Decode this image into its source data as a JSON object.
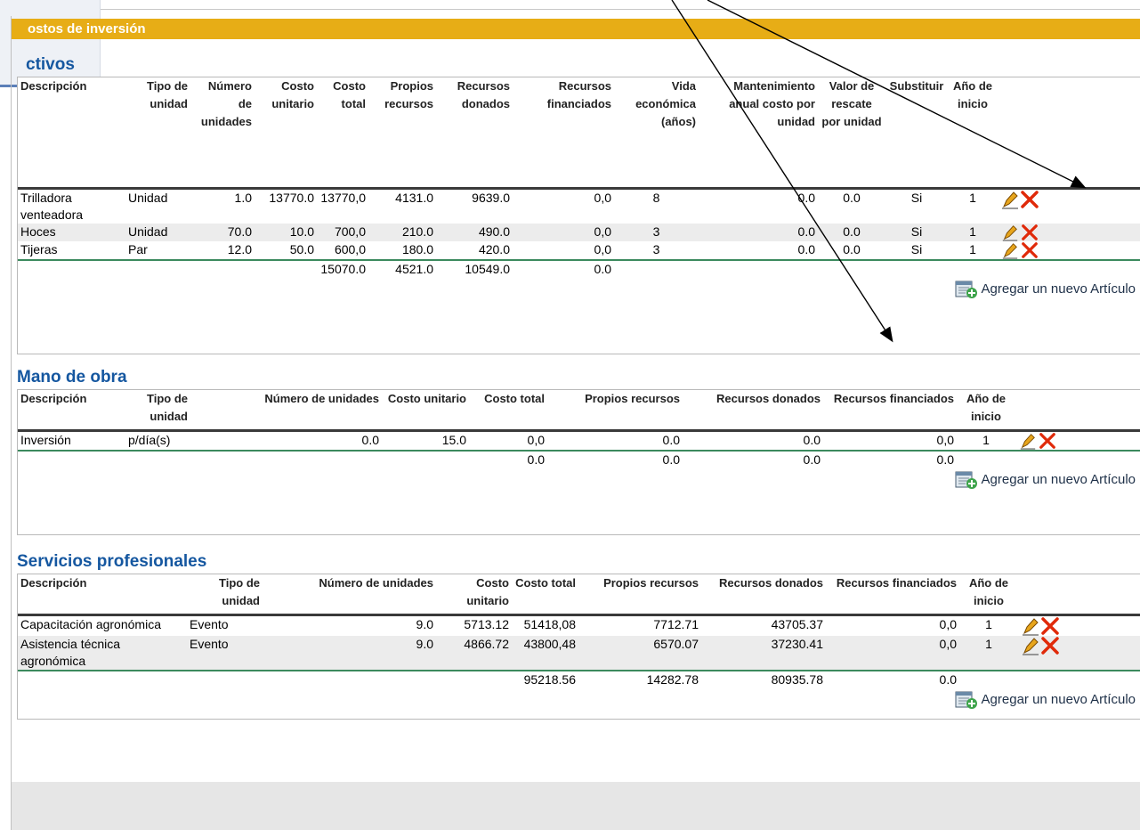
{
  "banner": "ostos de inversión",
  "activos": {
    "title": "ctivos",
    "headers": [
      "Descripción",
      "Tipo de unidad",
      "Número de unidades",
      "Costo unitario",
      "Costo total",
      "Propios recursos",
      "Recursos donados",
      "Recursos financiados",
      "Vida económica (años)",
      "Mantenimiento anual costo por unidad",
      "Valor de rescate por unidad",
      "Substituir",
      "Año de inicio"
    ],
    "rows": [
      [
        "Trilladora venteadora",
        "Unidad",
        "1.0",
        "13770.0",
        "13770,0",
        "4131.0",
        "9639.0",
        "0,0",
        "8",
        "0.0",
        "0.0",
        "Si",
        "1"
      ],
      [
        "Hoces",
        "Unidad",
        "70.0",
        "10.0",
        "700,0",
        "210.0",
        "490.0",
        "0,0",
        "3",
        "0.0",
        "0.0",
        "Si",
        "1"
      ],
      [
        "Tijeras",
        "Par",
        "12.0",
        "50.0",
        "600,0",
        "180.0",
        "420.0",
        "0,0",
        "3",
        "0.0",
        "0.0",
        "Si",
        "1"
      ]
    ],
    "totals": {
      "costo_total": "15070.0",
      "propios": "4521.0",
      "donados": "10549.0",
      "financiados": "0.0"
    },
    "add_label": "Agregar un nuevo Artículo"
  },
  "mano_obra": {
    "title": "Mano de obra",
    "headers": [
      "Descripción",
      "Tipo de unidad",
      "Número de unidades",
      "Costo unitario",
      "Costo total",
      "Propios recursos",
      "Recursos donados",
      "Recursos financiados",
      "Año de inicio"
    ],
    "rows": [
      [
        "Inversión",
        "p/día(s)",
        "0.0",
        "15.0",
        "0,0",
        "0.0",
        "0.0",
        "0,0",
        "1"
      ]
    ],
    "totals": {
      "costo_total": "0.0",
      "propios": "0.0",
      "donados": "0.0",
      "financiados": "0.0"
    },
    "add_label": "Agregar un nuevo Artículo"
  },
  "servicios": {
    "title": "Servicios profesionales",
    "headers": [
      "Descripción",
      "Tipo de unidad",
      "Número de unidades",
      "Costo unitario",
      "Costo total",
      "Propios recursos",
      "Recursos donados",
      "Recursos financiados",
      "Año de inicio"
    ],
    "rows": [
      [
        "Capacitación agronómica",
        "Evento",
        "9.0",
        "5713.12",
        "51418,08",
        "7712.71",
        "43705.37",
        "0,0",
        "1"
      ],
      [
        "Asistencia técnica agronómica",
        "Evento",
        "9.0",
        "4866.72",
        "43800,48",
        "6570.07",
        "37230.41",
        "0,0",
        "1"
      ]
    ],
    "totals": {
      "costo_total": "95218.56",
      "propios": "14282.78",
      "donados": "80935.78",
      "financiados": "0.0"
    },
    "add_label": "Agregar un nuevo Artículo"
  },
  "colors": {
    "banner": "#e7ad16",
    "section_title": "#1557a0",
    "delete": "#e02a0a",
    "edit": "#e7a51c"
  },
  "icons": {
    "edit": "pencil-icon",
    "delete": "delete-x-icon",
    "add": "add-item-icon"
  }
}
